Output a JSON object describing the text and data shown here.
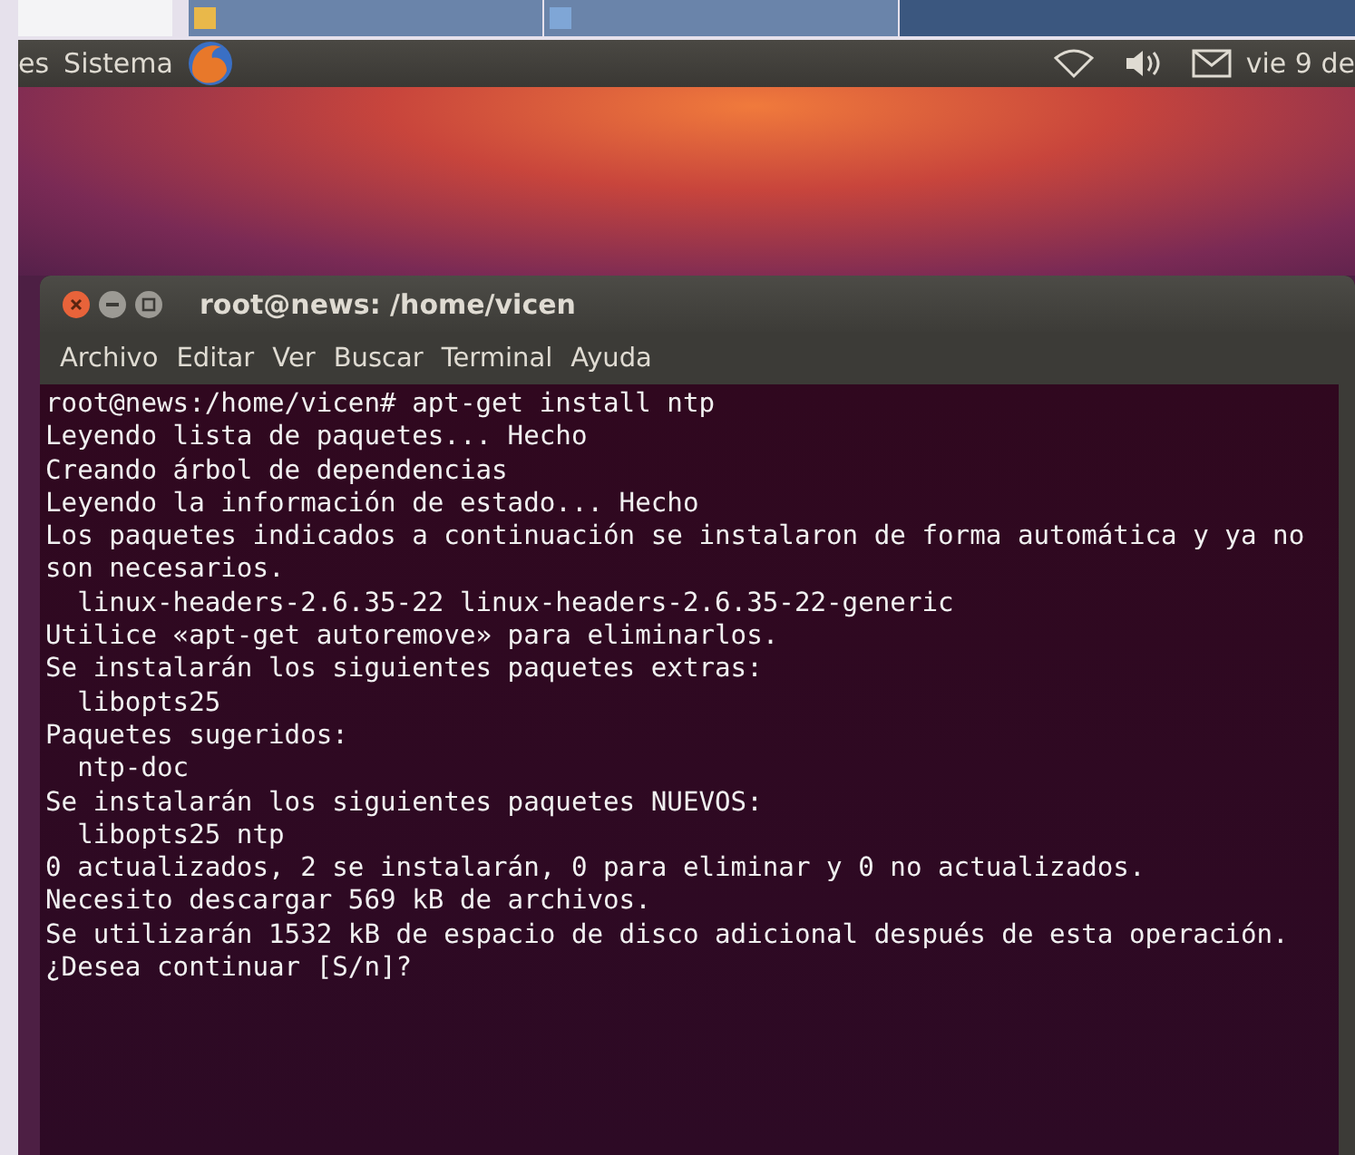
{
  "top_panel": {
    "menus": [
      "es",
      "Sistema"
    ],
    "clock": "vie 9 de"
  },
  "terminal": {
    "title": "root@news: /home/vicen",
    "menu": [
      "Archivo",
      "Editar",
      "Ver",
      "Buscar",
      "Terminal",
      "Ayuda"
    ],
    "lines": [
      "root@news:/home/vicen# apt-get install ntp",
      "Leyendo lista de paquetes... Hecho",
      "Creando árbol de dependencias",
      "Leyendo la información de estado... Hecho",
      "Los paquetes indicados a continuación se instalaron de forma automática y ya no",
      "son necesarios.",
      "  linux-headers-2.6.35-22 linux-headers-2.6.35-22-generic",
      "Utilice «apt-get autoremove» para eliminarlos.",
      "Se instalarán los siguientes paquetes extras:",
      "  libopts25",
      "Paquetes sugeridos:",
      "  ntp-doc",
      "Se instalarán los siguientes paquetes NUEVOS:",
      "  libopts25 ntp",
      "0 actualizados, 2 se instalarán, 0 para eliminar y 0 no actualizados.",
      "Necesito descargar 569 kB de archivos.",
      "Se utilizarán 1532 kB de espacio de disco adicional después de esta operación.",
      "¿Desea continuar [S/n]?"
    ]
  }
}
